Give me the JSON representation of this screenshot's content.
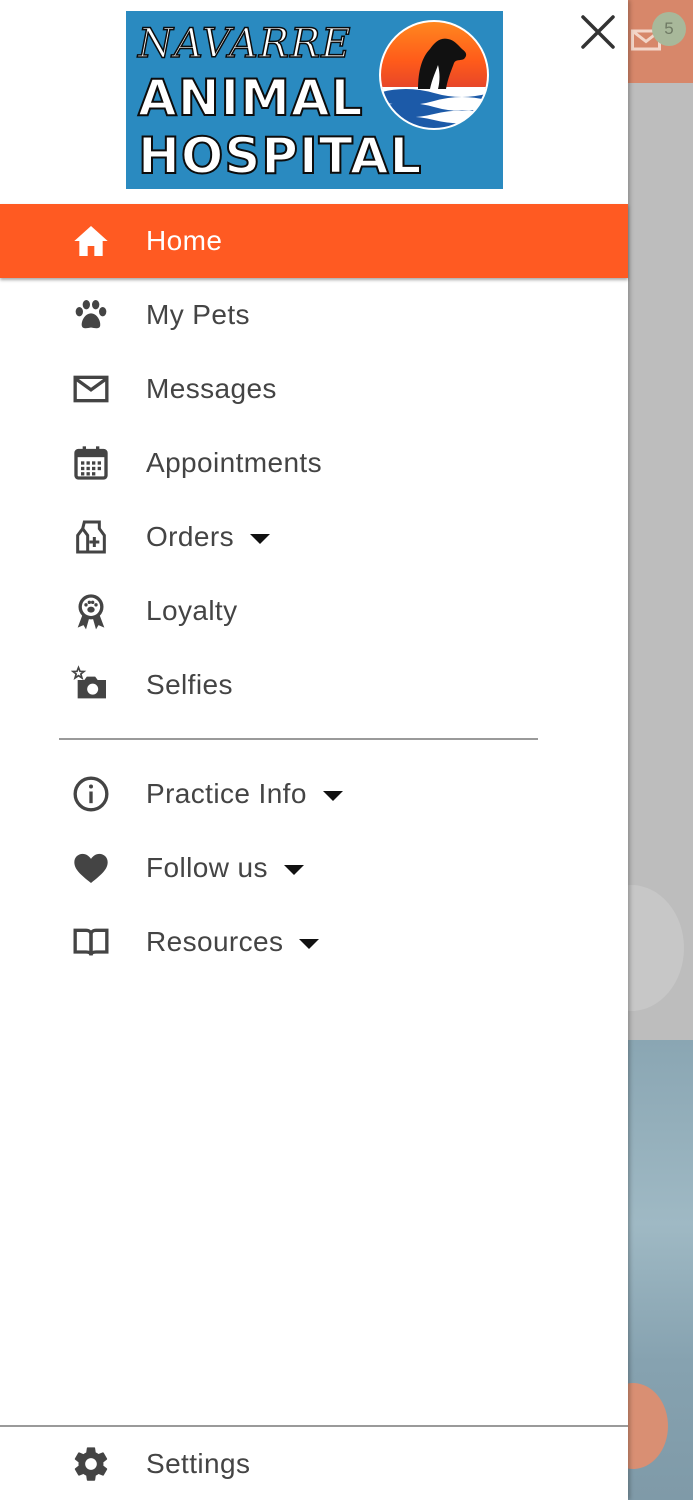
{
  "logo": {
    "line1": "NAVARRE",
    "line2": "ANIMAL",
    "line3": "HOSPITAL"
  },
  "colors": {
    "accent": "#ff5a22",
    "logo_bg": "#2a8ac0",
    "icon": "#444444"
  },
  "background": {
    "badge_count": "5"
  },
  "menu": [
    {
      "label": "Home",
      "icon": "home-icon",
      "active": true
    },
    {
      "label": "My Pets",
      "icon": "paw-icon"
    },
    {
      "label": "Messages",
      "icon": "envelope-icon"
    },
    {
      "label": "Appointments",
      "icon": "calendar-icon"
    },
    {
      "label": "Orders",
      "icon": "medicine-bag-icon",
      "expandable": true
    },
    {
      "label": "Loyalty",
      "icon": "paw-ribbon-icon"
    },
    {
      "label": "Selfies",
      "icon": "camera-star-icon"
    }
  ],
  "menu2": [
    {
      "label": "Practice Info",
      "icon": "info-icon",
      "expandable": true
    },
    {
      "label": "Follow us",
      "icon": "heart-icon",
      "expandable": true
    },
    {
      "label": "Resources",
      "icon": "book-icon",
      "expandable": true
    }
  ],
  "settings": {
    "label": "Settings",
    "icon": "gear-icon"
  }
}
